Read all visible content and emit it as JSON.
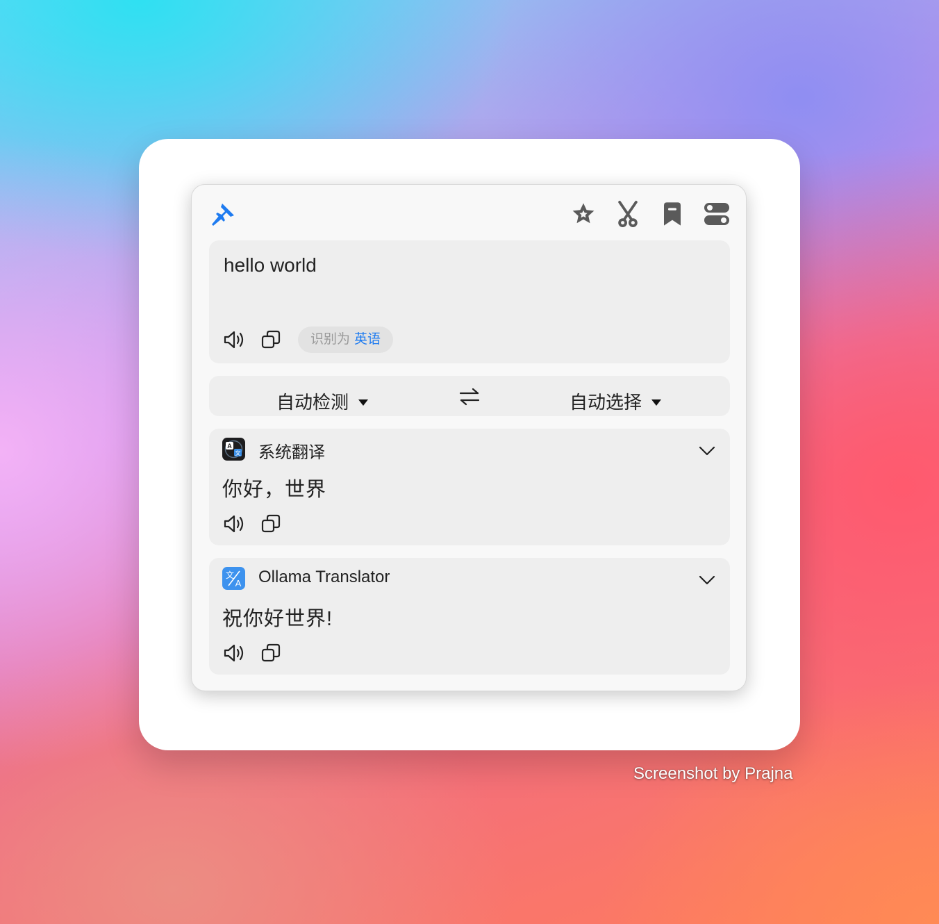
{
  "toolbar": {
    "pin_icon": "pin-icon",
    "icons": [
      "star-icon",
      "scissors-icon",
      "bookmark-icon",
      "toggles-icon"
    ],
    "accent_color": "#1e7bf0"
  },
  "input": {
    "text": "hello world",
    "detected_prefix": "识别为",
    "detected_language": "英语"
  },
  "languages": {
    "source": "自动检测",
    "target": "自动选择"
  },
  "services": [
    {
      "name": "系统翻译",
      "icon": "system-translate-icon",
      "result": "你好，世界"
    },
    {
      "name": "Ollama Translator",
      "icon": "ollama-translate-icon",
      "result": "祝你好世界!"
    }
  ],
  "watermark": "Screenshot by Prajna"
}
